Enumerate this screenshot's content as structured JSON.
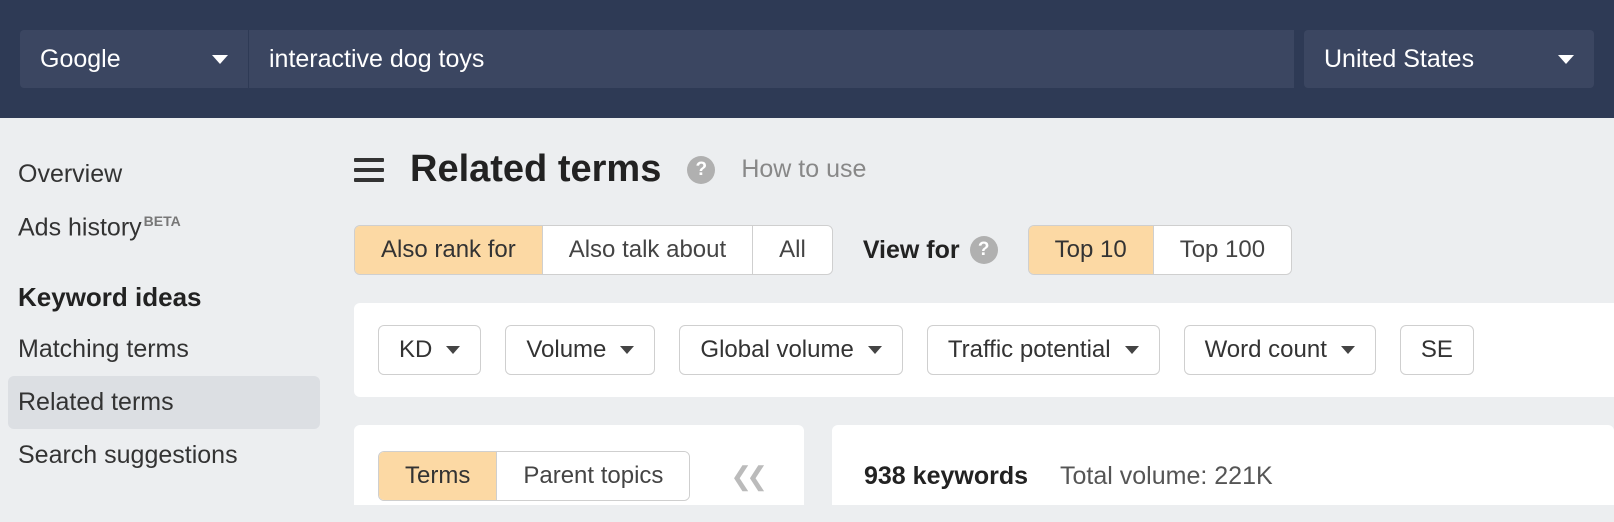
{
  "topbar": {
    "engine": "Google",
    "query": "interactive dog toys",
    "country": "United States"
  },
  "sidebar": {
    "items": [
      {
        "label": "Overview"
      },
      {
        "label": "Ads history",
        "badge": "BETA"
      }
    ],
    "heading": "Keyword ideas",
    "subitems": [
      {
        "label": "Matching terms"
      },
      {
        "label": "Related terms",
        "active": true
      },
      {
        "label": "Search suggestions"
      }
    ]
  },
  "header": {
    "title": "Related terms",
    "how_to_use": "How to use"
  },
  "toggles": {
    "group1": [
      "Also rank for",
      "Also talk about",
      "All"
    ],
    "group1_active": 0,
    "view_for_label": "View for",
    "group2": [
      "Top 10",
      "Top 100"
    ],
    "group2_active": 0
  },
  "filters": [
    "KD",
    "Volume",
    "Global volume",
    "Traffic potential",
    "Word count",
    "SE"
  ],
  "tabs": {
    "items": [
      "Terms",
      "Parent topics"
    ],
    "active": 0
  },
  "results": {
    "count": "938",
    "count_label": "keywords",
    "total_volume_label": "Total volume:",
    "total_volume_value": "221K"
  }
}
